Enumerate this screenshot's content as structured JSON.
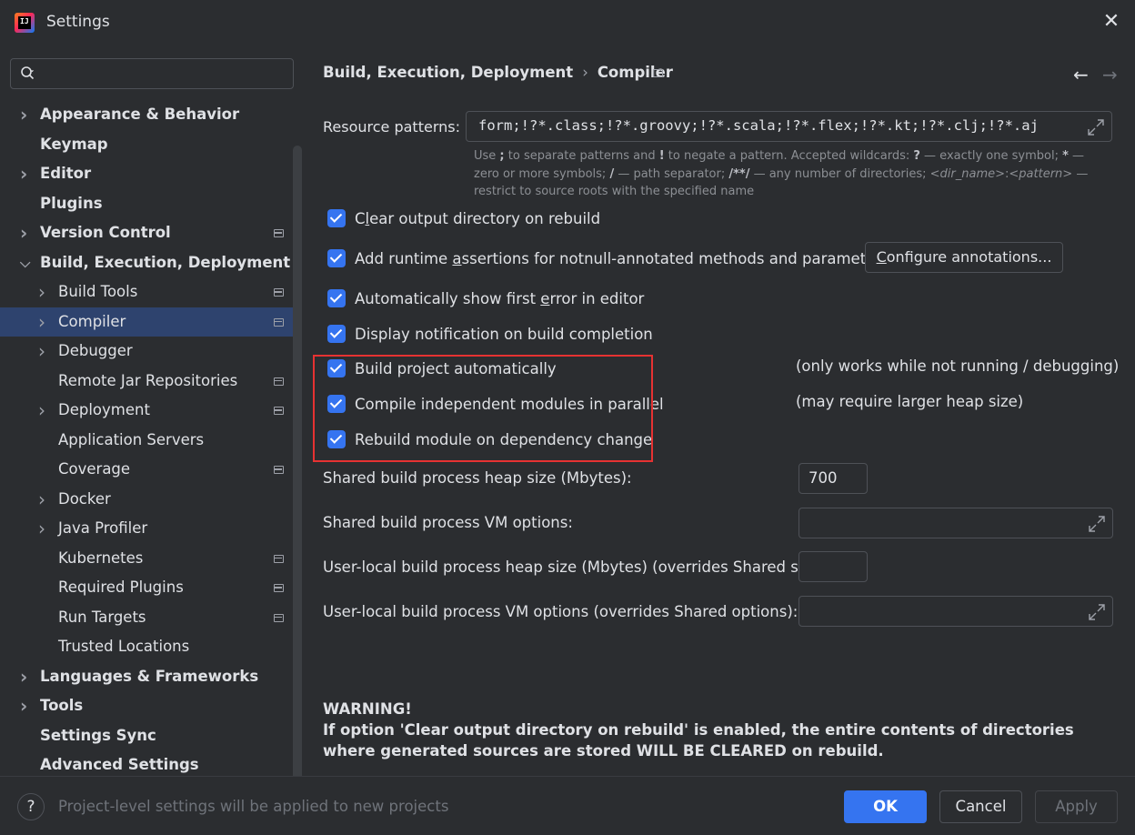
{
  "window": {
    "title": "Settings",
    "logo_text": "IJ"
  },
  "sidebar": {
    "search_placeholder": "",
    "items": [
      {
        "label": "Appearance & Behavior",
        "level": 0,
        "bold": true,
        "expandable": true,
        "expanded": false,
        "project": false
      },
      {
        "label": "Keymap",
        "level": 0,
        "bold": true,
        "expandable": false,
        "project": false
      },
      {
        "label": "Editor",
        "level": 0,
        "bold": true,
        "expandable": true,
        "expanded": false,
        "project": false
      },
      {
        "label": "Plugins",
        "level": 0,
        "bold": true,
        "expandable": false,
        "project": false
      },
      {
        "label": "Version Control",
        "level": 0,
        "bold": true,
        "expandable": true,
        "expanded": false,
        "project": true
      },
      {
        "label": "Build, Execution, Deployment",
        "level": 0,
        "bold": true,
        "expandable": true,
        "expanded": true,
        "project": false
      },
      {
        "label": "Build Tools",
        "level": 1,
        "bold": false,
        "expandable": true,
        "expanded": false,
        "project": true
      },
      {
        "label": "Compiler",
        "level": 1,
        "bold": false,
        "expandable": true,
        "expanded": false,
        "project": true,
        "selected": true
      },
      {
        "label": "Debugger",
        "level": 1,
        "bold": false,
        "expandable": true,
        "expanded": false,
        "project": false
      },
      {
        "label": "Remote Jar Repositories",
        "level": 1,
        "bold": false,
        "expandable": false,
        "project": true
      },
      {
        "label": "Deployment",
        "level": 1,
        "bold": false,
        "expandable": true,
        "expanded": false,
        "project": true
      },
      {
        "label": "Application Servers",
        "level": 1,
        "bold": false,
        "expandable": false,
        "project": false
      },
      {
        "label": "Coverage",
        "level": 1,
        "bold": false,
        "expandable": false,
        "project": true
      },
      {
        "label": "Docker",
        "level": 1,
        "bold": false,
        "expandable": true,
        "expanded": false,
        "project": false
      },
      {
        "label": "Java Profiler",
        "level": 1,
        "bold": false,
        "expandable": true,
        "expanded": false,
        "project": false
      },
      {
        "label": "Kubernetes",
        "level": 1,
        "bold": false,
        "expandable": false,
        "project": true
      },
      {
        "label": "Required Plugins",
        "level": 1,
        "bold": false,
        "expandable": false,
        "project": true
      },
      {
        "label": "Run Targets",
        "level": 1,
        "bold": false,
        "expandable": false,
        "project": true
      },
      {
        "label": "Trusted Locations",
        "level": 1,
        "bold": false,
        "expandable": false,
        "project": false
      },
      {
        "label": "Languages & Frameworks",
        "level": 0,
        "bold": true,
        "expandable": true,
        "expanded": false,
        "project": false
      },
      {
        "label": "Tools",
        "level": 0,
        "bold": true,
        "expandable": true,
        "expanded": false,
        "project": false
      },
      {
        "label": "Settings Sync",
        "level": 0,
        "bold": true,
        "expandable": false,
        "project": false
      },
      {
        "label": "Advanced Settings",
        "level": 0,
        "bold": true,
        "expandable": false,
        "project": false
      }
    ]
  },
  "breadcrumb": {
    "parent": "Build, Execution, Deployment",
    "separator": "›",
    "current": "Compiler"
  },
  "nav": {
    "back": "←",
    "forward": "→"
  },
  "resource_patterns": {
    "label": "Resource patterns:",
    "value": "form;!?*.class;!?*.groovy;!?*.scala;!?*.flex;!?*.kt;!?*.clj;!?*.aj",
    "hint": {
      "p1": "Use ",
      "b1": ";",
      "p2": " to separate patterns and ",
      "b2": "!",
      "p3": " to negate a pattern. Accepted wildcards: ",
      "b3": "?",
      "p4": " — exactly one symbol; ",
      "b4": "*",
      "p5": " — zero or more symbols; ",
      "b5": "/",
      "p6": " — path separator; ",
      "b6": "/**/",
      "p7": " — any number of directories; ",
      "i1": "<dir_name>",
      "p8": ":",
      "i2": "<pattern>",
      "p9": " — restrict to source roots with the specified name"
    }
  },
  "options": {
    "clear_output": {
      "pre": "C",
      "u": "l",
      "post": "ear output directory on rebuild",
      "checked": true
    },
    "runtime_assertions": {
      "pre": "Add runtime ",
      "u": "a",
      "post": "ssertions for notnull-annotated methods and parameters",
      "checked": true
    },
    "configure_button": {
      "pre": "",
      "u": "C",
      "post": "onfigure annotations..."
    },
    "show_first_error": {
      "pre": "Automatically show first ",
      "u": "e",
      "post": "rror in editor",
      "checked": true
    },
    "notify_completion": {
      "label": "Display notification on build completion",
      "checked": true
    },
    "build_auto": {
      "label": "Build project automatically",
      "note": "(only works while not running / debugging)",
      "checked": true
    },
    "compile_parallel": {
      "label": "Compile independent modules in parallel",
      "note": "(may require larger heap size)",
      "checked": true
    },
    "rebuild_dep": {
      "label": "Rebuild module on dependency change",
      "checked": true
    }
  },
  "fields": {
    "shared_heap": {
      "label": "Shared build process heap size (Mbytes):",
      "value": "700"
    },
    "shared_vm": {
      "label": "Shared build process VM options:",
      "value": ""
    },
    "local_heap": {
      "label": "User-local build process heap size (Mbytes) (overrides Shared size):",
      "value": ""
    },
    "local_vm": {
      "label": "User-local build process VM options (overrides Shared options):",
      "value": ""
    }
  },
  "warning": {
    "title": "WARNING!",
    "text": "If option 'Clear output directory on rebuild' is enabled, the entire contents of directories where generated sources are stored WILL BE CLEARED on rebuild."
  },
  "footer": {
    "help": "?",
    "text": "Project-level settings will be applied to new projects",
    "ok": "OK",
    "cancel": "Cancel",
    "apply": "Apply"
  },
  "colors": {
    "accent": "#3574f0",
    "selection": "#2e436e",
    "highlight_box": "#e63232",
    "background": "#2b2d30"
  }
}
